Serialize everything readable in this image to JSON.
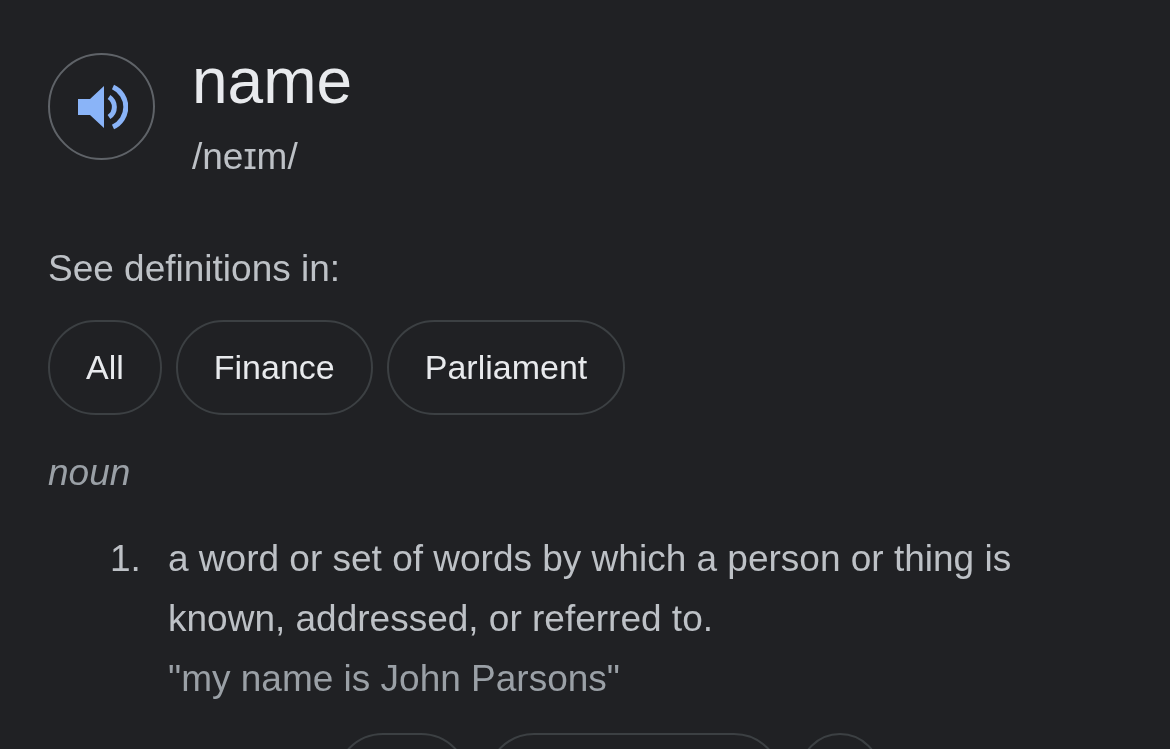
{
  "word": {
    "title": "name",
    "phonetic": "/neɪm/"
  },
  "domains": {
    "label": "See definitions in:",
    "chips": [
      {
        "label": "All",
        "selected": false
      },
      {
        "label": "Finance",
        "selected": false
      },
      {
        "label": "Parliament",
        "selected": false
      }
    ]
  },
  "part_of_speech": "noun",
  "definitions": [
    {
      "number": "1.",
      "text": "a word or set of words by which a person or thing is known, addressed, or referred to.",
      "example": "\"my name is John Parsons\""
    }
  ]
}
